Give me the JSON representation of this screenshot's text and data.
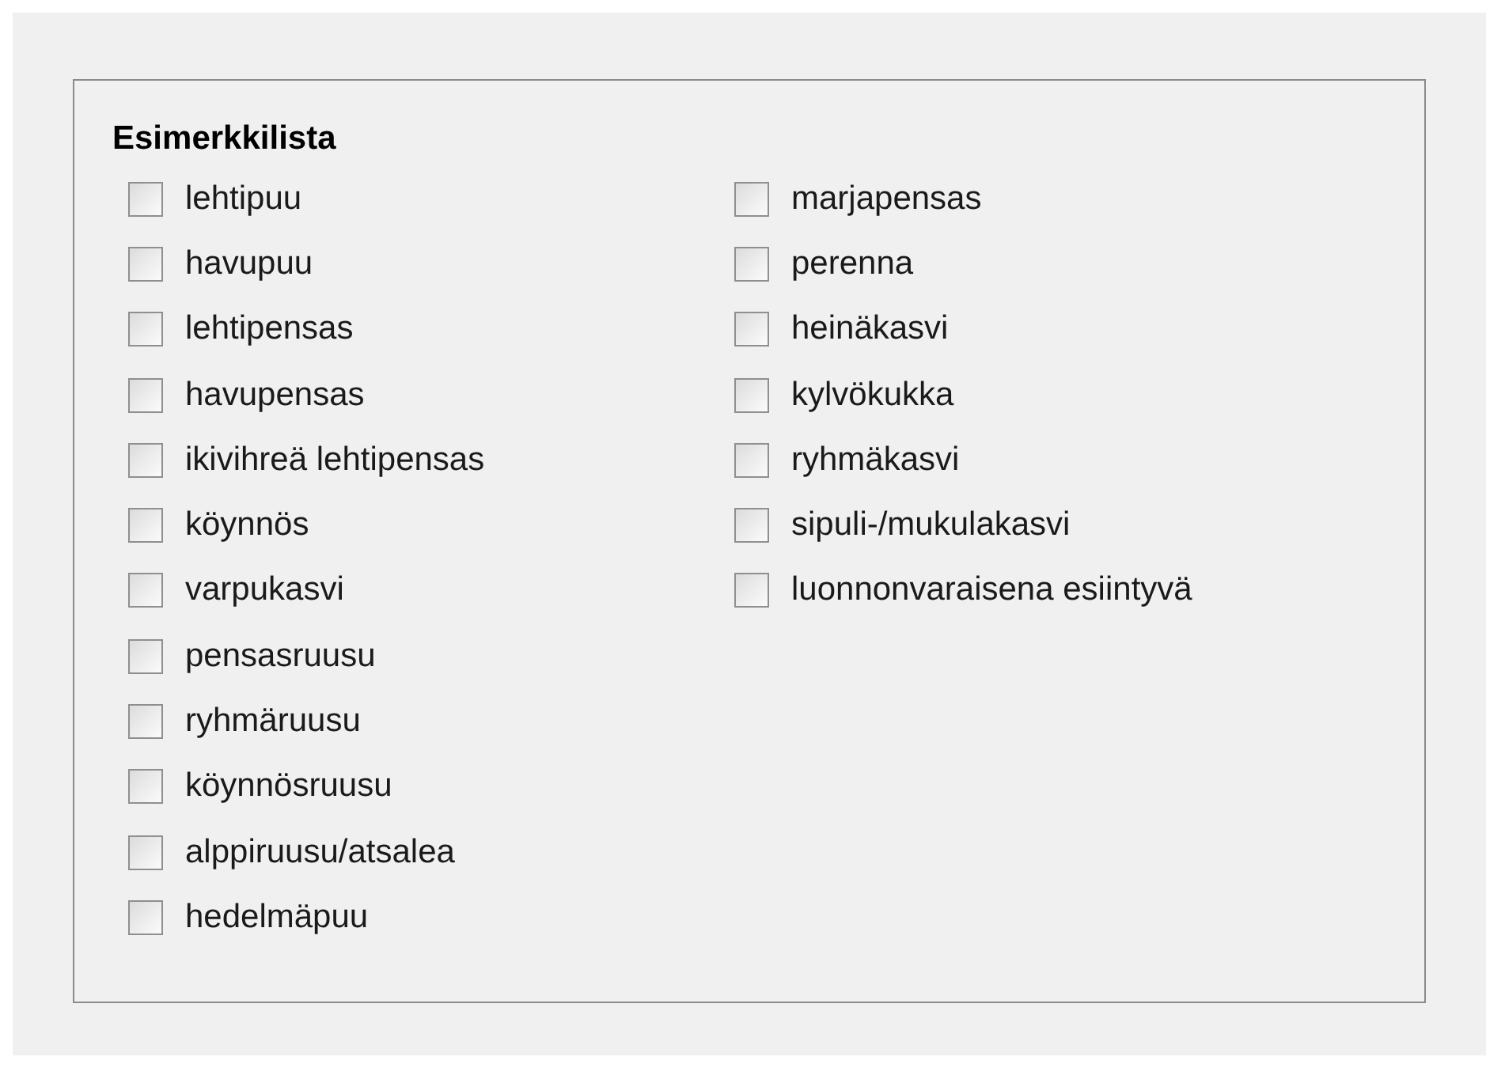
{
  "group": {
    "title": "Esimerkkilista",
    "columns": [
      {
        "items": [
          {
            "label": "lehtipuu",
            "checked": false
          },
          {
            "label": "havupuu",
            "checked": false
          },
          {
            "label": "lehtipensas",
            "checked": false
          },
          {
            "label": "havupensas",
            "checked": false
          },
          {
            "label": "ikivihreä lehtipensas",
            "checked": false
          },
          {
            "label": "köynnös",
            "checked": false
          },
          {
            "label": "varpukasvi",
            "checked": false
          },
          {
            "label": "pensasruusu",
            "checked": false
          },
          {
            "label": "ryhmäruusu",
            "checked": false
          },
          {
            "label": "köynnösruusu",
            "checked": false
          },
          {
            "label": "alppiruusu/atsalea",
            "checked": false
          },
          {
            "label": "hedelmäpuu",
            "checked": false
          }
        ]
      },
      {
        "items": [
          {
            "label": "marjapensas",
            "checked": false
          },
          {
            "label": "perenna",
            "checked": false
          },
          {
            "label": "heinäkasvi",
            "checked": false
          },
          {
            "label": "kylvökukka",
            "checked": false
          },
          {
            "label": "ryhmäkasvi",
            "checked": false
          },
          {
            "label": "sipuli-/mukulakasvi",
            "checked": false
          },
          {
            "label": "luonnonvaraisena esiintyvä",
            "checked": false
          }
        ]
      }
    ]
  }
}
